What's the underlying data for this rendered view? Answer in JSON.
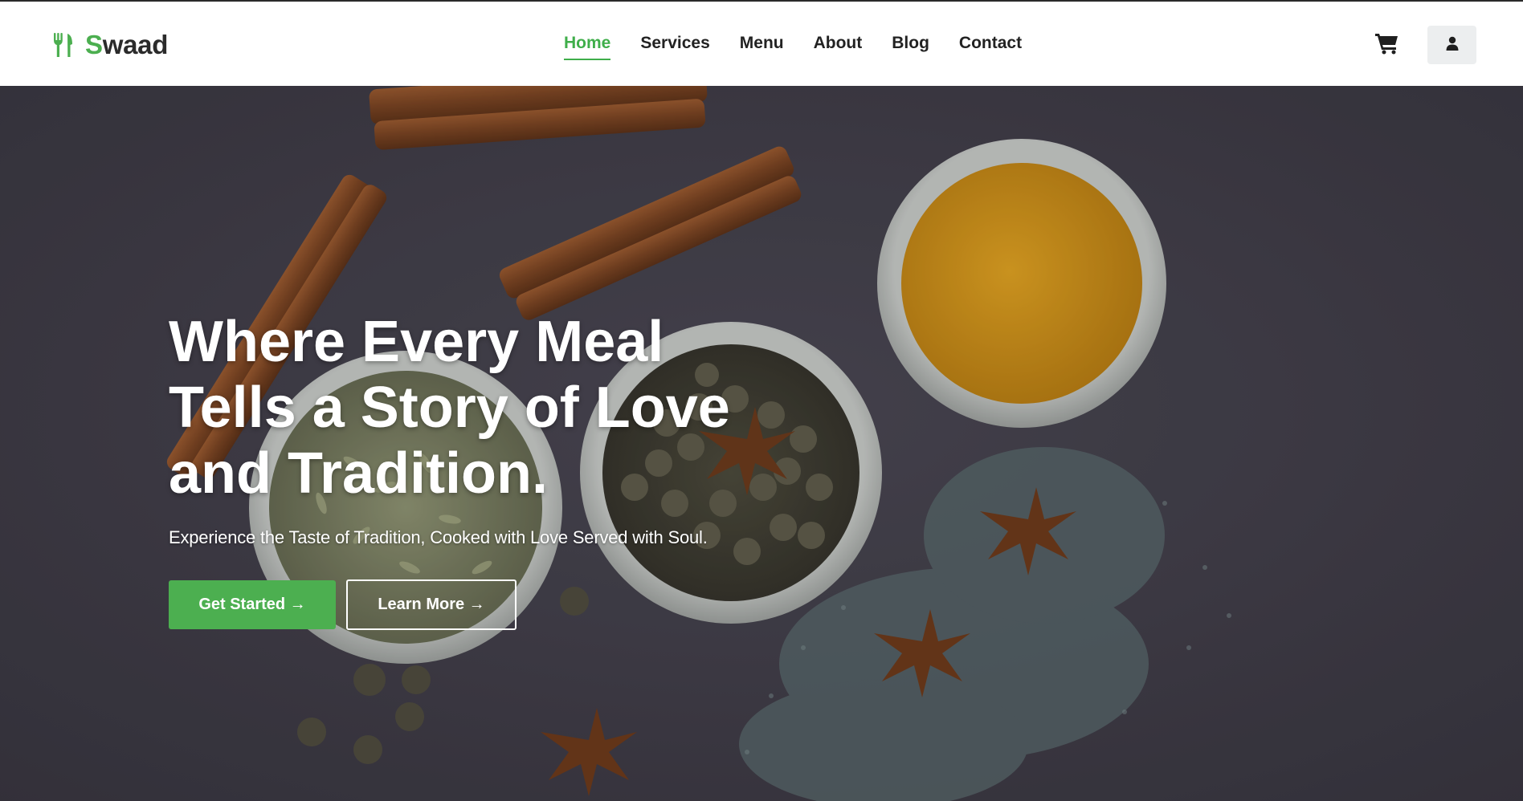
{
  "brand": {
    "logo_first_letter": "S",
    "logo_rest": "waad",
    "icon": "fork-knife-icon",
    "accent_color": "#4caf50"
  },
  "nav": {
    "items": [
      {
        "label": "Home",
        "active": true
      },
      {
        "label": "Services",
        "active": false
      },
      {
        "label": "Menu",
        "active": false
      },
      {
        "label": "About",
        "active": false
      },
      {
        "label": "Blog",
        "active": false
      },
      {
        "label": "Contact",
        "active": false
      }
    ],
    "cart_icon": "cart-icon",
    "user_icon": "user-icon"
  },
  "hero": {
    "title": "Where Every Meal Tells a Story of Love and Tradition.",
    "subtitle": "Experience the Taste of Tradition, Cooked with Love Served with Soul.",
    "primary_button": "Get Started →",
    "secondary_button": "Learn More →",
    "background": "spices-photo"
  }
}
